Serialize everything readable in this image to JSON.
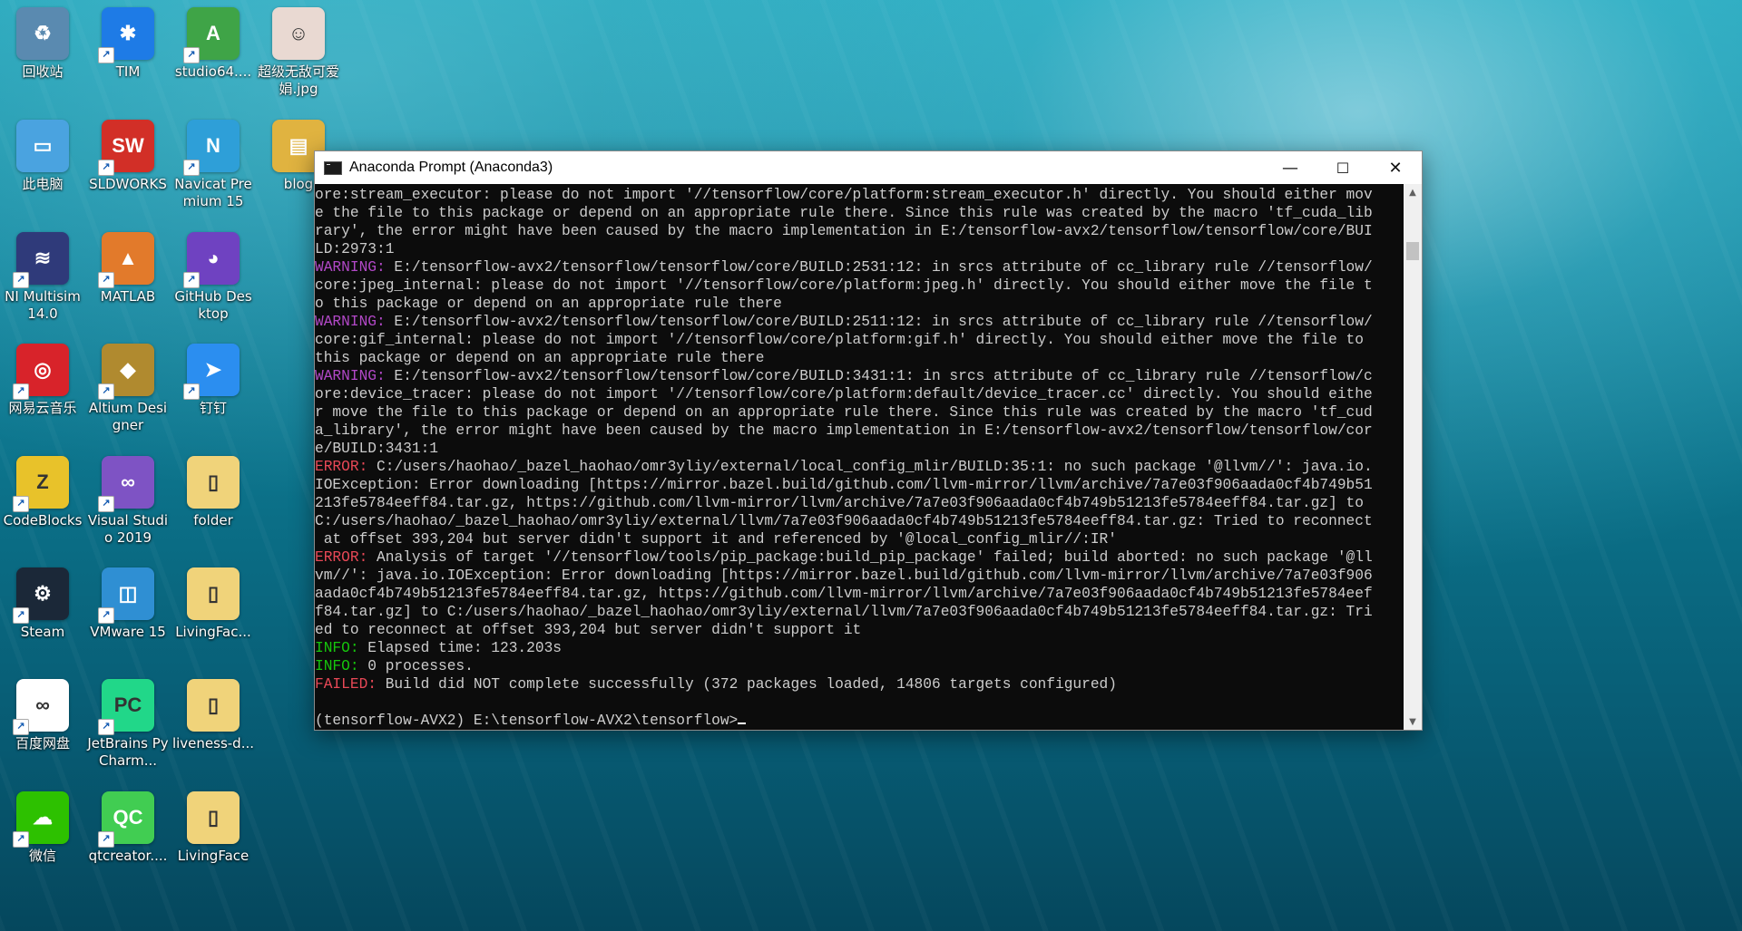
{
  "desktop": {
    "icons": [
      {
        "label": "回收站",
        "icon": "recycle-bin-icon",
        "color": "#5a8ab0"
      },
      {
        "label": "TIM",
        "icon": "tim-icon",
        "color": "#1e7be6"
      },
      {
        "label": "studio64....",
        "icon": "android-studio-icon",
        "color": "#3fa447"
      },
      {
        "label": "超级无敌可爱娟.jpg",
        "icon": "photo-icon",
        "color": "#e9d9d2"
      },
      {
        "label": "此电脑",
        "icon": "computer-icon",
        "color": "#4aa3e0"
      },
      {
        "label": "SLDWORKS",
        "icon": "solidworks-icon",
        "color": "#d22f27"
      },
      {
        "label": "Navicat Premium 15",
        "icon": "navicat-icon",
        "color": "#2e9fd8"
      },
      {
        "label": "blog",
        "icon": "folder-archive-icon",
        "color": "#e0b340"
      },
      {
        "label": "NI Multisim 14.0",
        "icon": "multisim-icon",
        "color": "#2f3a7a"
      },
      {
        "label": "MATLAB",
        "icon": "matlab-icon",
        "color": "#e27a2b"
      },
      {
        "label": "GitHub Desktop",
        "icon": "github-icon",
        "color": "#6f42c1"
      },
      {
        "label": "网易云音乐",
        "icon": "netease-music-icon",
        "color": "#d8232a"
      },
      {
        "label": "Altium Designer",
        "icon": "altium-icon",
        "color": "#b08a2f"
      },
      {
        "label": "钉钉",
        "icon": "dingtalk-icon",
        "color": "#2b8ef0"
      },
      {
        "label": "CodeBlocks",
        "icon": "codeblocks-icon",
        "color": "#e8c22a"
      },
      {
        "label": "Visual Studio 2019",
        "icon": "visual-studio-icon",
        "color": "#7e53c4"
      },
      {
        "label": "folder",
        "icon": "folder-icon",
        "color": "#f0d37a"
      },
      {
        "label": "Steam",
        "icon": "steam-icon",
        "color": "#1b2838"
      },
      {
        "label": "VMware 15",
        "icon": "vmware-icon",
        "color": "#2f8fd3"
      },
      {
        "label": "LivingFac...",
        "icon": "folder-icon",
        "color": "#f0d37a"
      },
      {
        "label": "百度网盘",
        "icon": "baidu-netdisk-icon",
        "color": "#ffffff"
      },
      {
        "label": "JetBrains PyCharm...",
        "icon": "pycharm-icon",
        "color": "#21d789"
      },
      {
        "label": "liveness-d...",
        "icon": "folder-icon",
        "color": "#f0d37a"
      },
      {
        "label": "微信",
        "icon": "wechat-icon",
        "color": "#2dc100"
      },
      {
        "label": "qtcreator....",
        "icon": "qtcreator-icon",
        "color": "#41cd52"
      },
      {
        "label": "LivingFace",
        "icon": "folder-icon",
        "color": "#f0d37a"
      }
    ]
  },
  "window": {
    "title": "Anaconda Prompt (Anaconda3)",
    "minimize": "—",
    "maximize": "☐",
    "close": "✕"
  },
  "terminal": {
    "lines": [
      {
        "text": "ore:stream_executor: please do not import '//tensorflow/core/platform:stream_executor.h' directly. You should either mov"
      },
      {
        "text": "e the file to this package or depend on an appropriate rule there. Since this rule was created by the macro 'tf_cuda_lib"
      },
      {
        "text": "rary', the error might have been caused by the macro implementation in E:/tensorflow-avx2/tensorflow/tensorflow/core/BUI"
      },
      {
        "text": "LD:2973:1"
      },
      {
        "tag": "WARNING:",
        "text": " E:/tensorflow-avx2/tensorflow/tensorflow/core/BUILD:2531:12: in srcs attribute of cc_library rule //tensorflow/"
      },
      {
        "text": "core:jpeg_internal: please do not import '//tensorflow/core/platform:jpeg.h' directly. You should either move the file t"
      },
      {
        "text": "o this package or depend on an appropriate rule there"
      },
      {
        "tag": "WARNING:",
        "text": " E:/tensorflow-avx2/tensorflow/tensorflow/core/BUILD:2511:12: in srcs attribute of cc_library rule //tensorflow/"
      },
      {
        "text": "core:gif_internal: please do not import '//tensorflow/core/platform:gif.h' directly. You should either move the file to"
      },
      {
        "text": "this package or depend on an appropriate rule there"
      },
      {
        "tag": "WARNING:",
        "text": " E:/tensorflow-avx2/tensorflow/tensorflow/core/BUILD:3431:1: in srcs attribute of cc_library rule //tensorflow/c"
      },
      {
        "text": "ore:device_tracer: please do not import '//tensorflow/core/platform:default/device_tracer.cc' directly. You should eithe"
      },
      {
        "text": "r move the file to this package or depend on an appropriate rule there. Since this rule was created by the macro 'tf_cud"
      },
      {
        "text": "a_library', the error might have been caused by the macro implementation in E:/tensorflow-avx2/tensorflow/tensorflow/cor"
      },
      {
        "text": "e/BUILD:3431:1"
      },
      {
        "tag": "ERROR:",
        "text": " C:/users/haohao/_bazel_haohao/omr3yliy/external/local_config_mlir/BUILD:35:1: no such package '@llvm//': java.io."
      },
      {
        "text": "IOException: Error downloading [https://mirror.bazel.build/github.com/llvm-mirror/llvm/archive/7a7e03f906aada0cf4b749b51"
      },
      {
        "text": "213fe5784eeff84.tar.gz, https://github.com/llvm-mirror/llvm/archive/7a7e03f906aada0cf4b749b51213fe5784eeff84.tar.gz] to"
      },
      {
        "text": "C:/users/haohao/_bazel_haohao/omr3yliy/external/llvm/7a7e03f906aada0cf4b749b51213fe5784eeff84.tar.gz: Tried to reconnect"
      },
      {
        "text": " at offset 393,204 but server didn't support it and referenced by '@local_config_mlir//:IR'"
      },
      {
        "tag": "ERROR:",
        "text": " Analysis of target '//tensorflow/tools/pip_package:build_pip_package' failed; build aborted: no such package '@ll"
      },
      {
        "text": "vm//': java.io.IOException: Error downloading [https://mirror.bazel.build/github.com/llvm-mirror/llvm/archive/7a7e03f906"
      },
      {
        "text": "aada0cf4b749b51213fe5784eeff84.tar.gz, https://github.com/llvm-mirror/llvm/archive/7a7e03f906aada0cf4b749b51213fe5784eef"
      },
      {
        "text": "f84.tar.gz] to C:/users/haohao/_bazel_haohao/omr3yliy/external/llvm/7a7e03f906aada0cf4b749b51213fe5784eeff84.tar.gz: Tri"
      },
      {
        "text": "ed to reconnect at offset 393,204 but server didn't support it"
      },
      {
        "tag": "INFO:",
        "text": " Elapsed time: 123.203s"
      },
      {
        "tag": "INFO:",
        "text": " 0 processes."
      },
      {
        "tag": "FAILED:",
        "text": " Build did NOT complete successfully (372 packages loaded, 14806 targets configured)"
      },
      {
        "text": ""
      },
      {
        "text": "(tensorflow-AVX2) E:\\tensorflow-AVX2\\tensorflow>",
        "cursor": true
      }
    ],
    "tag_colors": {
      "WARNING:": "#b148c6",
      "ERROR:": "#e74856",
      "INFO:": "#16c60c",
      "FAILED:": "#e74856"
    }
  }
}
